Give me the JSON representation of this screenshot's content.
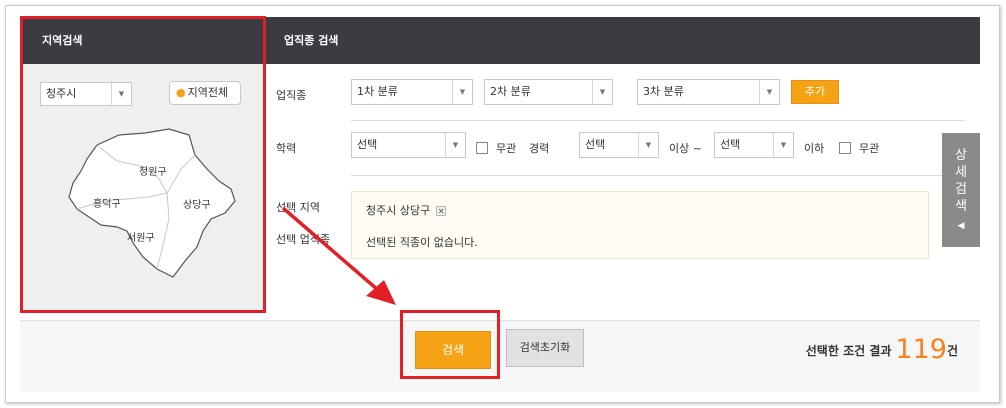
{
  "region_panel": {
    "title": "지역검색",
    "city_select": "청주시",
    "all_region_button": "지역전체",
    "map_districts": [
      "청원구",
      "흥덕구",
      "상당구",
      "서원구"
    ]
  },
  "job_panel": {
    "title": "업직종 검색",
    "job_label": "업직종",
    "category1": "1차 분류",
    "category2": "2차 분류",
    "category3": "3차 분류",
    "add_button": "추가",
    "education_label": "학력",
    "education_select": "선택",
    "no_matter_label": "무관",
    "career_label": "경력",
    "career_from_select": "선택",
    "above_label": "이상 ~",
    "career_to_select": "선택",
    "below_label": "이하",
    "no_matter_label2": "무관",
    "selected_region_label": "선택 지역",
    "selected_region_value": "청주시 상당구",
    "selected_job_label": "선택 업직종",
    "selected_job_value": "선택된 직종이 없습니다."
  },
  "detail_tab": {
    "chars": [
      "상",
      "세",
      "검",
      "색"
    ],
    "arrow": "◀"
  },
  "bottom": {
    "search_button": "검색",
    "reset_button": "검색초기화",
    "result_label": "선택한 조건 결과",
    "result_count": "119",
    "result_unit": "건"
  },
  "colors": {
    "accent_orange": "#f5a315",
    "header_dark": "#3a3c41",
    "highlight_red": "#e01f26",
    "count_orange": "#f5821f"
  }
}
